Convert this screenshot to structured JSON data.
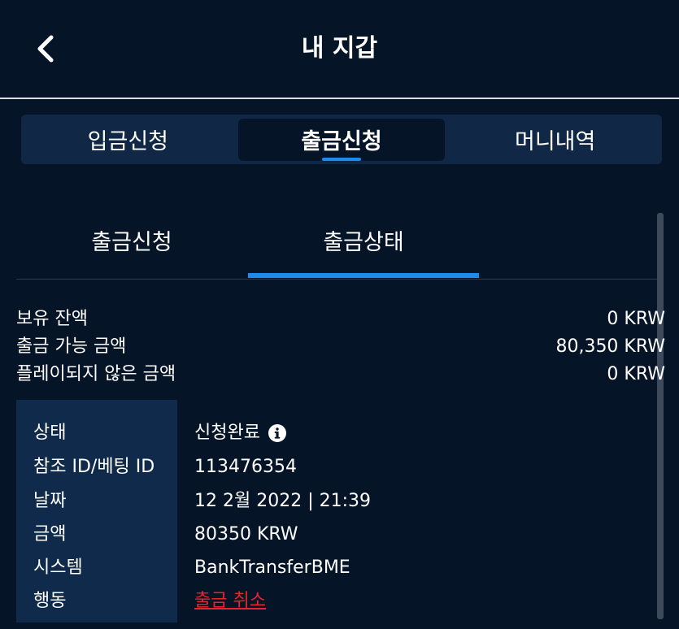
{
  "header": {
    "title": "내 지갑",
    "back_icon": "chevron-left-icon"
  },
  "main_tabs": [
    {
      "label": "입금신청",
      "active": false
    },
    {
      "label": "출금신청",
      "active": true
    },
    {
      "label": "머니내역",
      "active": false
    }
  ],
  "sub_tabs": [
    {
      "label": "출금신청",
      "active": false
    },
    {
      "label": "출금상태",
      "active": true
    }
  ],
  "balances": [
    {
      "label": "보유 잔액",
      "value": "0 KRW"
    },
    {
      "label": "출금 가능 금액",
      "value": "80,350 KRW"
    },
    {
      "label": "플레이되지 않은 금액",
      "value": "0 KRW"
    }
  ],
  "status": {
    "rows": [
      {
        "label": "상태",
        "value": "신청완료"
      },
      {
        "label": "참조 ID/베팅 ID",
        "value": "113476354"
      },
      {
        "label": "날짜",
        "value": "12 2월 2022 | 21:39"
      },
      {
        "label": "금액",
        "value": "80350 KRW"
      },
      {
        "label": "시스템",
        "value": "BankTransferBME"
      },
      {
        "label": "행동",
        "value": "출금 취소"
      }
    ],
    "info_icon": "info-circle-icon"
  },
  "colors": {
    "background": "#061428",
    "tab_bar": "#102846",
    "accent": "#1a8cf0",
    "label_panel": "#0f2a4a",
    "cancel_link": "#e4262c"
  }
}
